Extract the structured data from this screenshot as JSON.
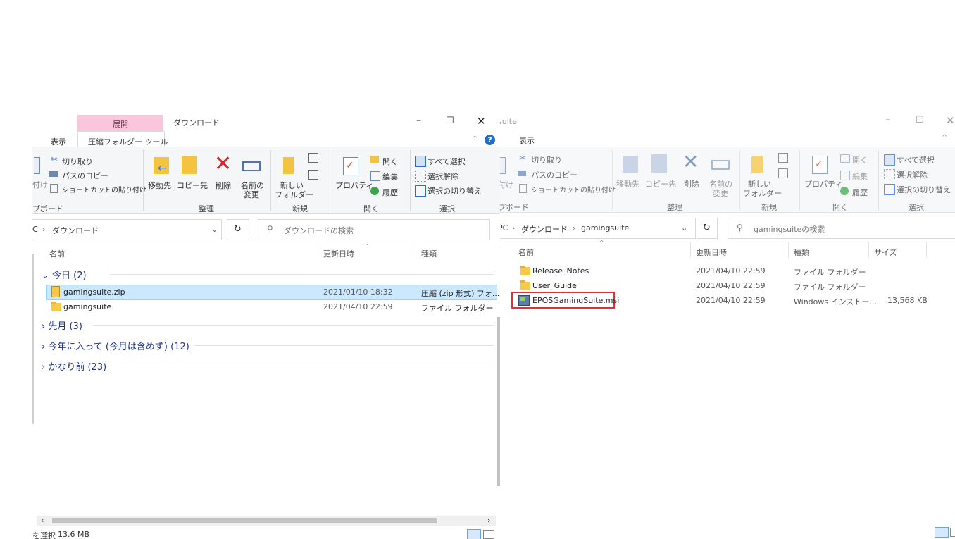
{
  "left_window": {
    "contextual_tab": "展開",
    "title": "ダウンロード",
    "tabs": [
      "表示",
      "圧縮フォルダー ツール"
    ],
    "clipboard": {
      "cut": "切り取り",
      "copy_path": "パスのコピー",
      "paste_shortcut": "ショートカットの貼り付け",
      "paste_partial": "付け",
      "label": "プボード"
    },
    "organize": {
      "move_to": "移動先",
      "copy_to": "コピー先",
      "delete": "削除",
      "rename_line1": "名前の",
      "rename_line2": "変更",
      "label": "整理"
    },
    "new": {
      "new_folder_line1": "新しい",
      "new_folder_line2": "フォルダー",
      "label": "新規"
    },
    "open": {
      "properties": "プロパティ",
      "open": "開く",
      "edit": "編集",
      "history": "履歴",
      "label": "開く"
    },
    "select": {
      "select_all": "すべて選択",
      "select_none": "選択解除",
      "invert": "選択の切り替え",
      "label": "選択"
    },
    "address": {
      "prefix": "C",
      "crumb": "ダウンロード"
    },
    "search_placeholder": "ダウンロードの検索",
    "columns": {
      "name": "名前",
      "date": "更新日時",
      "type": "種類"
    },
    "group_today": "今日 (2)",
    "files": [
      {
        "name": "gamingsuite.zip",
        "date": "2021/01/10 18:32",
        "type": "圧縮 (zip 形式) フォ..."
      },
      {
        "name": "gamingsuite",
        "date": "2021/04/10 22:59",
        "type": "ファイル フォルダー"
      }
    ],
    "groups_collapsed": [
      "先月 (3)",
      "今年に入って (今月は含めず) (12)",
      "かなり前 (23)"
    ],
    "status": {
      "selected": "を選択",
      "size": "13.6 MB"
    }
  },
  "right_window": {
    "title_fragment": "suite",
    "tab": "表示",
    "clipboard": {
      "cut": "切り取り",
      "copy_path": "パスのコピー",
      "paste_shortcut": "ショートカットの貼り付け",
      "paste_partial": "付け",
      "label": "プボード"
    },
    "organize": {
      "move_to": "移動先",
      "copy_to": "コピー先",
      "delete": "削除",
      "rename_line1": "名前の",
      "rename_line2": "変更",
      "label": "整理"
    },
    "new": {
      "new_folder_line1": "新しい",
      "new_folder_line2": "フォルダー",
      "label": "新規"
    },
    "open": {
      "properties": "プロパティ",
      "open": "開く",
      "edit": "編集",
      "history": "履歴",
      "label": "開く"
    },
    "select": {
      "select_all": "すべて選択",
      "select_none": "選択解除",
      "invert": "選択の切り替え",
      "label": "選択"
    },
    "address": {
      "prefix": "PC",
      "crumb1": "ダウンロード",
      "crumb2": "gamingsuite"
    },
    "search_placeholder": "gamingsuiteの検索",
    "columns": {
      "name": "名前",
      "date": "更新日時",
      "type": "種類",
      "size": "サイズ"
    },
    "files": [
      {
        "name": "Release_Notes",
        "date": "2021/04/10 22:59",
        "type": "ファイル フォルダー",
        "size": ""
      },
      {
        "name": "User_Guide",
        "date": "2021/04/10 22:59",
        "type": "ファイル フォルダー",
        "size": ""
      },
      {
        "name": "EPOSGamingSuite.msi",
        "date": "2021/04/10 22:59",
        "type": "Windows インストー...",
        "size": "13,568 KB"
      }
    ]
  },
  "colors": {
    "selection": "#cce8ff",
    "highlight_border": "#e0313a",
    "context_tab": "#f9c6dc",
    "link_blue": "#1e3287"
  }
}
